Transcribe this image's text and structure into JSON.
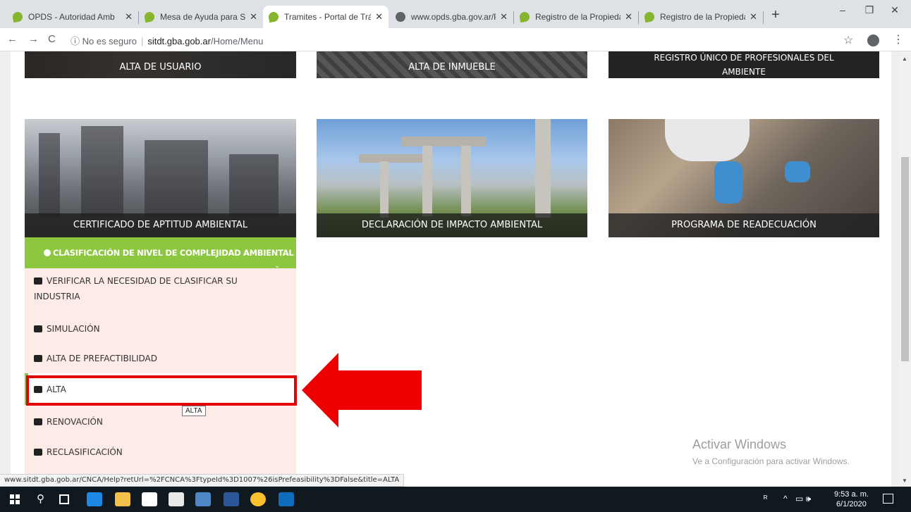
{
  "browser": {
    "tabs": [
      {
        "title": "OPDS - Autoridad Amb",
        "icon": "opds-leaf-icon"
      },
      {
        "title": "Mesa de Ayuda para Si",
        "icon": "opds-leaf-icon"
      },
      {
        "title": "Tramites - Portal de Trá",
        "icon": "opds-leaf-icon",
        "active": true
      },
      {
        "title": "www.opds.gba.gov.ar/P",
        "icon": "globe-icon"
      },
      {
        "title": "Registro de la Propieda",
        "icon": "opds-leaf-icon"
      },
      {
        "title": "Registro de la Propieda",
        "icon": "opds-leaf-icon"
      }
    ],
    "close_glyph": "✕",
    "new_tab": "+",
    "window_controls": {
      "minimize": "–",
      "restore": "❐",
      "close": "✕"
    },
    "nav": {
      "back": "←",
      "forward": "→",
      "reload": "C"
    },
    "address": {
      "security": "ⓘ No es seguro",
      "separator": "|",
      "host": "sitdt.gba.gob.ar",
      "path": "/Home/Menu"
    },
    "star": "☆",
    "menu": "⋮",
    "status_url": "www.sitdt.gba.gob.ar/CNCA/Help?retUrl=%2FCNCA%3FtypeId%3D1007%26isPrefeasibility%3DFalse&title=ALTA"
  },
  "cards_top": [
    {
      "label": "ALTA DE USUARIO"
    },
    {
      "label": "ALTA DE INMUEBLE"
    },
    {
      "label_line1": "REGISTRO ÚNICO DE PROFESIONALES DEL",
      "label_line2": "AMBIENTE"
    }
  ],
  "cards_mid": [
    {
      "label": "CERTIFICADO DE APTITUD AMBIENTAL"
    },
    {
      "label": "DECLARACIÓN DE IMPACTO AMBIENTAL"
    },
    {
      "label": "PROGRAMA DE READECUACIÓN"
    }
  ],
  "accordion": {
    "header": "CLASIFICACIÓN DE NIVEL DE COMPLEJIDAD AMBIENTAL",
    "caret": "⌄",
    "items": [
      {
        "line1": "VERIFICAR LA NECESIDAD DE CLASIFICAR SU",
        "line2": "INDUSTRIA"
      },
      {
        "line1": "SIMULACIÓN"
      },
      {
        "line1": "ALTA DE PREFACTIBILIDAD"
      },
      {
        "line1": "ALTA"
      },
      {
        "line1": "RENOVACIÓN"
      },
      {
        "line1": "RECLASIFICACIÓN"
      }
    ]
  },
  "tooltip": "ALTA",
  "annotation": {
    "highlight_color": "#e30000",
    "arrow_color": "#ee0000"
  },
  "watermark": {
    "title": "Activar Windows",
    "subtitle": "Ve a Configuración para activar Windows."
  },
  "taskbar": {
    "search_icon": "⚲",
    "tray": {
      "people": "ᴿ",
      "chevron": "^",
      "network_volume": "▭ 🕪",
      "time": "9:53 a. m.",
      "date": "6/1/2020"
    }
  },
  "colors": {
    "accent_green": "#8dc63f",
    "submenu_bg": "#fcebe7",
    "card_label_bg": "#1e1e1e"
  }
}
